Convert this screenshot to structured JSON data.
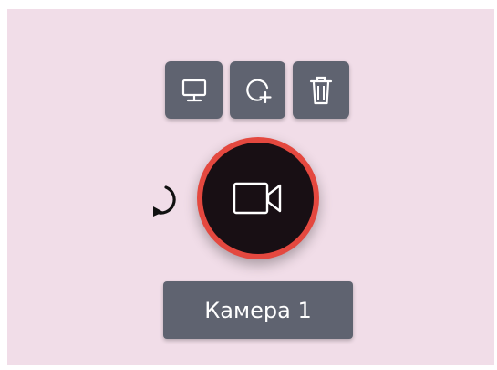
{
  "toolbar": {
    "buttons": [
      {
        "icon": "monitor-icon"
      },
      {
        "icon": "add-zone-icon"
      },
      {
        "icon": "trash-icon"
      }
    ]
  },
  "camera": {
    "icon": "video-camera-icon",
    "label": "Камера 1"
  },
  "rotate": {
    "icon": "rotate-icon"
  },
  "colors": {
    "canvas_bg": "#f1dde8",
    "button_bg": "#5f6370",
    "camera_ring": "#e4483f",
    "camera_fill": "#180f14"
  }
}
